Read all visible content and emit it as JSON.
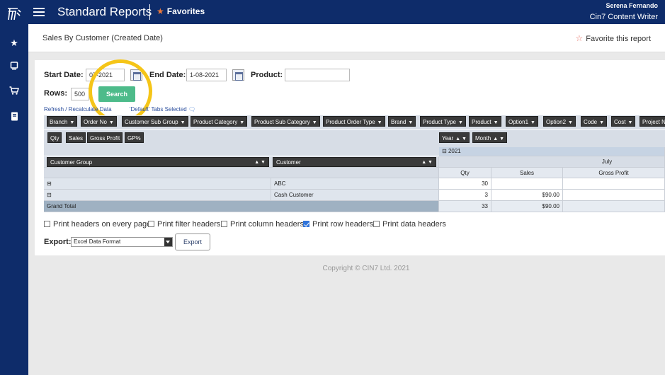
{
  "app": {
    "title": "Standard Reports",
    "favorites_label": "Favorites",
    "user_name": "Serena Fernando",
    "user_role": "Cin7 Content Writer"
  },
  "report": {
    "title": "Sales By Customer (Created Date)",
    "favorite_label": "Favorite this report"
  },
  "filters": {
    "start_date_label": "Start Date:",
    "start_date_value": "07-2021",
    "end_date_label": "End Date:",
    "end_date_value": "1-08-2021",
    "product_label": "Product:",
    "product_value": "",
    "rows_label": "Rows:",
    "rows_value": "500",
    "search_label": "Search"
  },
  "links": {
    "refresh": "Refresh / Recalculate Data",
    "tabs_selected": "'Default' Tabs Selected"
  },
  "dimensions": [
    "Branch",
    "Order No",
    "Customer Sub Group",
    "Product Category",
    "Product Sub Category",
    "Product Order Type",
    "Brand",
    "Product Type",
    "Product",
    "Option1",
    "Option2",
    "Code",
    "Cost",
    "Project N"
  ],
  "measures": [
    "Qty",
    "Sales",
    "Gross Profit",
    "GP%"
  ],
  "column_fields": [
    "Year",
    "Month"
  ],
  "grid": {
    "year": "2021",
    "month": "July",
    "row_headers": [
      "Customer Group",
      "Customer"
    ],
    "col_headers": [
      "Qty",
      "Sales",
      "Gross Profit"
    ],
    "rows": [
      {
        "group": "",
        "customer": "ABC",
        "qty": "30",
        "sales": "",
        "gp": ""
      },
      {
        "group": "",
        "customer": "Cash Customer",
        "qty": "3",
        "sales": "$90.00",
        "gp": ""
      }
    ],
    "total": {
      "label": "Grand Total",
      "qty": "33",
      "sales": "$90.00",
      "gp": ""
    }
  },
  "print_options": [
    {
      "label": "Print headers on every page",
      "checked": false
    },
    {
      "label": "Print filter headers",
      "checked": false
    },
    {
      "label": "Print column headers",
      "checked": false
    },
    {
      "label": "Print row headers",
      "checked": true
    },
    {
      "label": "Print data headers",
      "checked": false
    }
  ],
  "export": {
    "label": "Export:",
    "format": "Excel Data Format",
    "button": "Export"
  },
  "footer": {
    "copyright": "Copyright © CIN7 Ltd. 2021"
  },
  "colors": {
    "navy": "#0e2c6a",
    "accent_orange": "#ef7a3a",
    "search_green": "#4dbb8a",
    "highlight_yellow": "#f5c518"
  }
}
